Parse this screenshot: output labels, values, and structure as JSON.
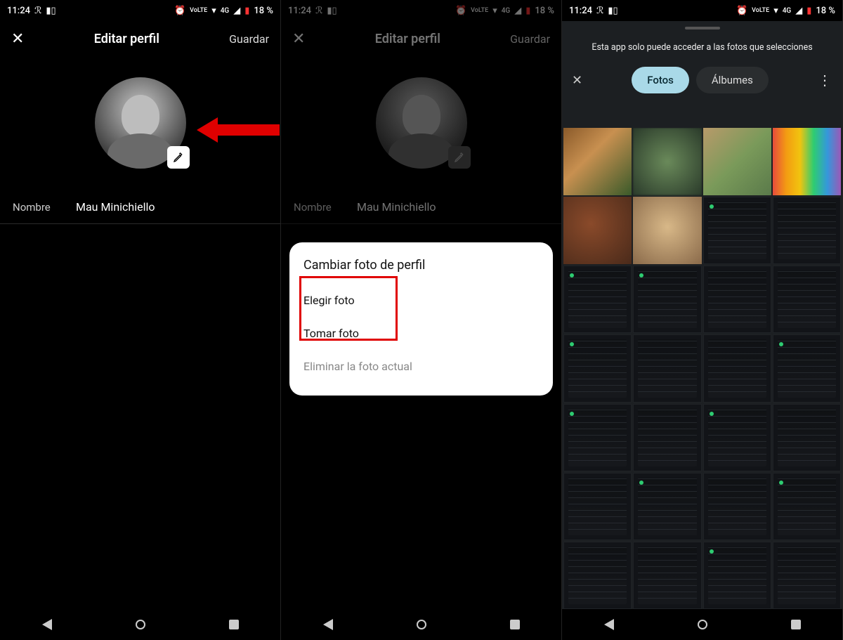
{
  "status": {
    "time": "11:24",
    "volte": "VoLTE",
    "net": "4G",
    "battery_pct": "18 %"
  },
  "screen1": {
    "header": {
      "title": "Editar perfil",
      "save": "Guardar"
    },
    "name_label": "Nombre",
    "name_value": "Mau Minichiello"
  },
  "screen2": {
    "header": {
      "title": "Editar perfil",
      "save": "Guardar"
    },
    "name_label": "Nombre",
    "name_value": "Mau Minichiello",
    "dialog": {
      "title": "Cambiar foto de perfil",
      "opt_choose": "Elegir foto",
      "opt_take": "Tomar foto",
      "opt_remove": "Eliminar la foto actual"
    }
  },
  "screen3": {
    "permission_msg": "Esta app solo puede acceder a las fotos que selecciones",
    "tab_photos": "Fotos",
    "tab_albums": "Álbumes"
  }
}
